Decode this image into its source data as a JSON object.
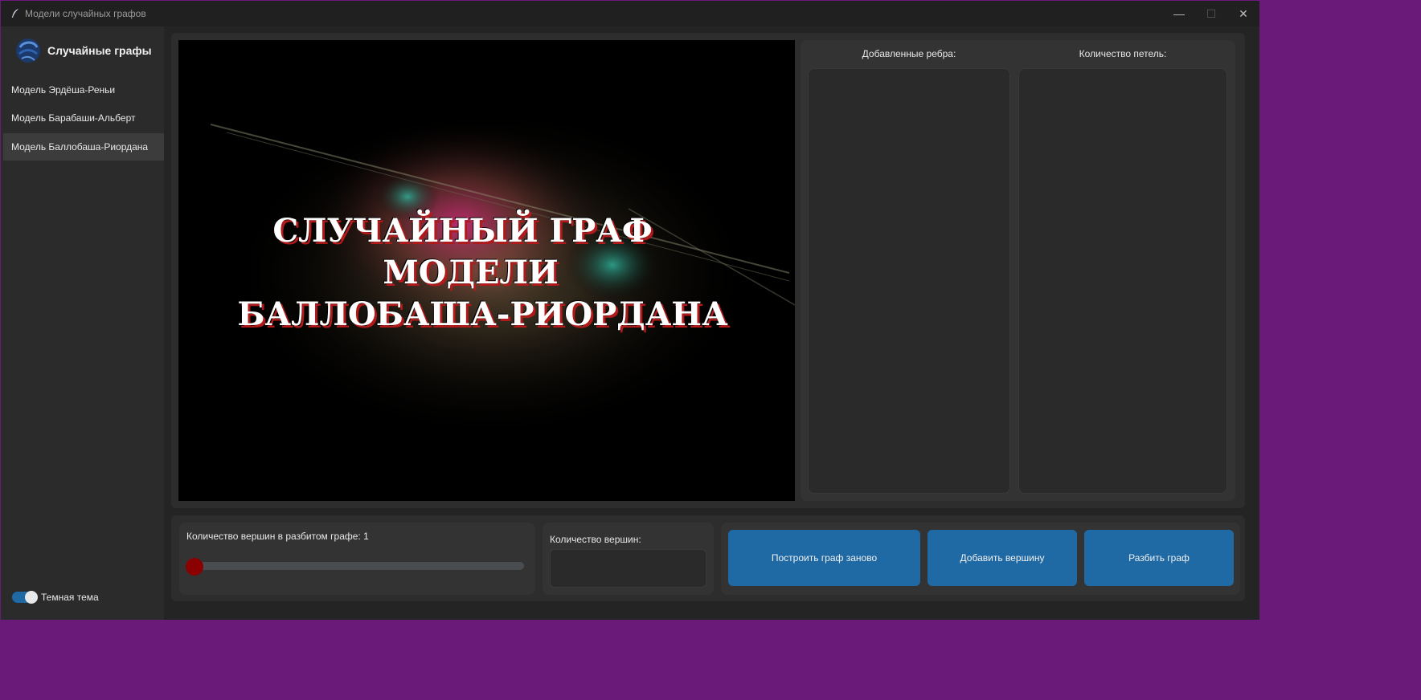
{
  "window": {
    "title": "Модели случайных графов",
    "controls": {
      "minimize": "—",
      "maximize": "☐",
      "close": "✕"
    }
  },
  "sidebar": {
    "brand_title": "Случайные графы",
    "items": [
      {
        "label": "Модель Эрдёша-Реньи",
        "active": false
      },
      {
        "label": "Модель Барабаши-Альберт",
        "active": false
      },
      {
        "label": "Модель Баллобаша-Риордана",
        "active": true
      }
    ],
    "theme_toggle": {
      "label": "Темная тема",
      "on": true
    }
  },
  "main": {
    "image_caption_lines": [
      "СЛУЧАЙНЫЙ ГРАФ",
      "МОДЕЛИ",
      "БАЛЛОБАША-РИОРДАНА"
    ],
    "right_panel": {
      "added_edges_label": "Добавленные ребра:",
      "loops_label": "Количество петель:"
    }
  },
  "bottom": {
    "split_vertices_label": "Количество вершин в разбитом графе: 1",
    "slider_value": 1,
    "vertices_count_label": "Количество вершин:",
    "vertices_count_value": "",
    "buttons": {
      "rebuild": "Построить граф заново",
      "add_vertex": "Добавить вершину",
      "split": "Разбить граф"
    }
  },
  "colors": {
    "accent": "#1f6aa5",
    "slider_knob": "#8b0000",
    "background": "#242424"
  }
}
